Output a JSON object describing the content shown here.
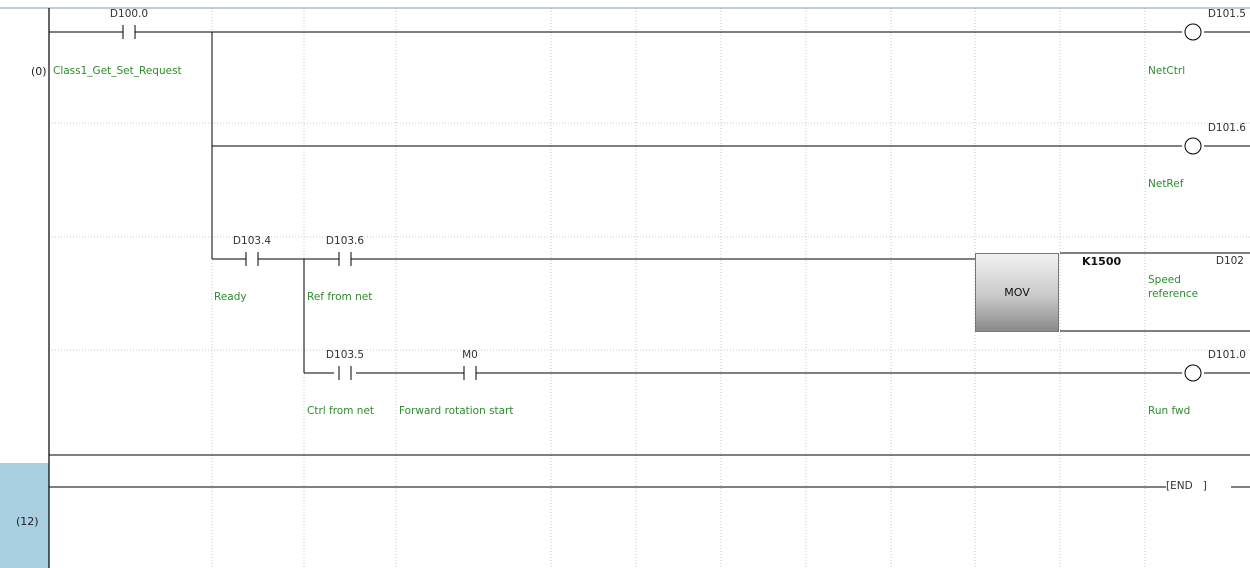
{
  "rungs": [
    {
      "step": "(0)",
      "contacts": [
        {
          "device": "D100.0",
          "comment": "Class1_Get_Set_Request"
        },
        {
          "device": "D103.4",
          "comment": "Ready"
        },
        {
          "device": "D103.6",
          "comment": "Ref from net"
        },
        {
          "device": "D103.5",
          "comment": "Ctrl from net"
        },
        {
          "device": "M0",
          "comment": "Forward rotation start"
        }
      ],
      "coils": [
        {
          "device": "D101.5",
          "comment": "NetCtrl"
        },
        {
          "device": "D101.6",
          "comment": "NetRef"
        },
        {
          "device": "D101.0",
          "comment": "Run fwd"
        }
      ],
      "instruction": {
        "name": "MOV",
        "source": "K1500",
        "destination": "D102",
        "destination_comment_line1": "Speed",
        "destination_comment_line2": "reference"
      }
    },
    {
      "step": "(12)",
      "end_instruction": "END"
    }
  ],
  "colors": {
    "wire": "#000000",
    "device_text": "#333333",
    "comment_text": "#2e8b2e",
    "grid": "#c8c8c8",
    "step_highlight": "#a9cfe0"
  }
}
